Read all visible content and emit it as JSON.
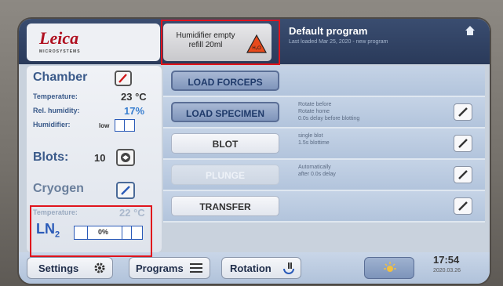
{
  "brand": {
    "name": "Leica",
    "subtitle": "MICROSYSTEMS"
  },
  "alert": {
    "text_line1": "Humidifier empty",
    "text_line2": "refill 20ml",
    "icon_text": "H₂O"
  },
  "program": {
    "title": "Default program",
    "subtitle": "Last loaded Mar 25, 2020 - new program"
  },
  "chamber": {
    "title": "Chamber",
    "temperature_label": "Temperature:",
    "temperature_value": "23 °C",
    "humidity_label": "Rel. humidity:",
    "humidity_value": "17%",
    "humidifier_label": "Humidifier:",
    "humidifier_level": "low"
  },
  "blots": {
    "label": "Blots:",
    "value": "10"
  },
  "cryogen": {
    "title": "Cryogen",
    "temperature_label": "Temperature:",
    "temperature_value": "22 °C",
    "ln2_label": "LN",
    "ln2_sub": "2",
    "ln2_level": "0%"
  },
  "steps": [
    {
      "label": "LOAD FORCEPS",
      "desc": ""
    },
    {
      "label": "LOAD SPECIMEN",
      "desc": "Rotate before\nRotate home\n0.0s delay before blotting"
    },
    {
      "label": "BLOT",
      "desc": "single blot\n1.5s blottime"
    },
    {
      "label": "PLUNGE",
      "desc": "Automatically\nafter 0.0s delay"
    },
    {
      "label": "TRANSFER",
      "desc": ""
    }
  ],
  "bottom": {
    "settings_label": "Settings",
    "programs_label": "Programs",
    "rotation_label": "Rotation",
    "time": "17:54",
    "date": "2020.03.26"
  },
  "colors": {
    "accent": "#3a5a8a",
    "alert_red": "#e0141c",
    "header": "#2a3a5a"
  }
}
